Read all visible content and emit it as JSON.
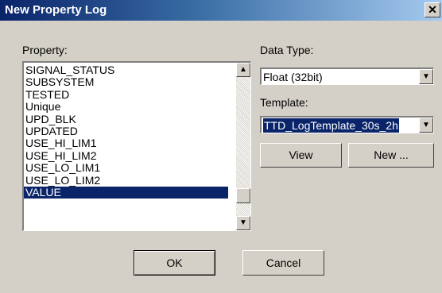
{
  "window": {
    "title": "New Property Log",
    "close_glyph": "✕"
  },
  "property": {
    "label": "Property:",
    "items": [
      "SIGNAL_STATUS",
      "SUBSYSTEM",
      "TESTED",
      "Unique",
      "UPD_BLK",
      "UPDATED",
      "USE_HI_LIM1",
      "USE_HI_LIM2",
      "USE_LO_LIM1",
      "USE_LO_LIM2",
      "VALUE"
    ],
    "selected": "VALUE",
    "scroll_position": 0.9
  },
  "data_type": {
    "label": "Data Type:",
    "value": "Float (32bit)"
  },
  "template": {
    "label": "Template:",
    "value": "TTD_LogTemplate_30s_2h"
  },
  "buttons": {
    "view": "View",
    "new": "New ...",
    "ok": "OK",
    "cancel": "Cancel"
  },
  "icons": {
    "scroll_up": "scroll-up-arrow-icon",
    "scroll_down": "scroll-down-arrow-icon",
    "dropdown": "chevron-down-icon"
  }
}
